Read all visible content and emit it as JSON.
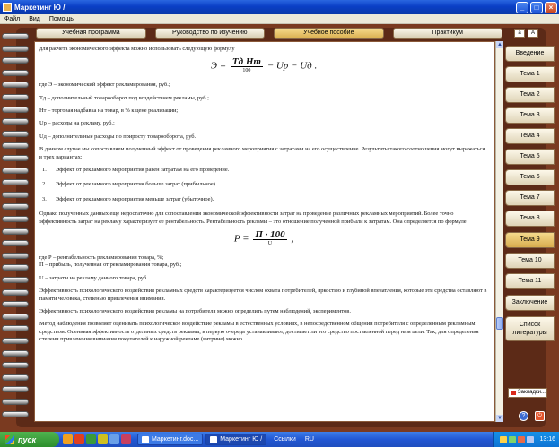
{
  "window": {
    "title": "Маркетинг Ю /"
  },
  "menu": [
    "Файл",
    "Вид",
    "Помощь"
  ],
  "tabs": [
    "Учебная программа",
    "Руководство по изучению",
    "Учебное пособие",
    "Практикум"
  ],
  "font_buttons": [
    "a",
    "A"
  ],
  "sidebar": [
    {
      "label": "Введение"
    },
    {
      "label": "Тема 1"
    },
    {
      "label": "Тема 2"
    },
    {
      "label": "Тема 3"
    },
    {
      "label": "Тема 4"
    },
    {
      "label": "Тема 5"
    },
    {
      "label": "Тема 6"
    },
    {
      "label": "Тема 7"
    },
    {
      "label": "Тема 8"
    },
    {
      "label": "Тема 9",
      "active": true
    },
    {
      "label": "Тема 10"
    },
    {
      "label": "Тема 11"
    },
    {
      "label": "Заключение"
    },
    {
      "label": "Список литературы"
    }
  ],
  "bookmark_label": "Закладки...",
  "help_label": "?",
  "content": {
    "intro": "для расчета экономического эффекта можно использовать следующую формулу",
    "formula1_left": "Э =",
    "formula1_num": "Tд Нт",
    "formula1_den": "100",
    "formula1_right": "− Uр − Uд .",
    "defs": [
      "где Э – экономический эффект рекламирования, руб.;",
      "Тд – дополнительный товарооборот под воздействием рекламы, руб.;",
      "Нт – торговая надбавка на товар, в % к цене реализации;",
      "Uр – расходы на рекламу, руб.;",
      "Uд – дополнительные расходы по приросту товарооборота, руб."
    ],
    "para1": "В данном случае мы сопоставляем полученный эффект от проведения рекламного мероприятия с затратами на его осуществление. Результаты такого соотношения могут выражаться в трех вариантах:",
    "list": [
      {
        "n": "1.",
        "text": "Эффект от рекламного мероприятия равен затратам на его проведение."
      },
      {
        "n": "2.",
        "text": "Эффект от рекламного мероприятия больше затрат (прибыльное)."
      },
      {
        "n": "3.",
        "text": "Эффект от рекламного мероприятия меньше затрат (убыточное)."
      }
    ],
    "para2": "Однако полученных данных еще недостаточно для сопоставления экономической эффективности затрат на проведение различных рекламных мероприятий. Более точно эффективность затрат на рекламу характеризует ее рентабельность. Рентабельность рекламы – это отношение полученной прибыли к затратам. Она определяется по формуле",
    "formula2_left": "P =",
    "formula2_num": "П · 100",
    "formula2_den": "U",
    "formula2_right": ",",
    "defs2_1": "где Р – рентабельность рекламирования товара, %;",
    "defs2_2": "П – прибыль, полученная от рекламирования товара, руб.;",
    "defs2_3": "U – затраты на рекламу данного товара, руб.",
    "para3": "Эффективность психологического воздействия рекламных средств характеризуется числом охвата потребителей, яркостью и глубиной впечатления, которые эти средства оставляют в памяти человека, степенью привлечения внимания.",
    "para4": "Эффективность психологического воздействия рекламы на потребителя можно определить путем наблюдений, экспериментов.",
    "para5": "Метод наблюдения позволяет оценивать психологическое воздействие рекламы в естественных условиях, в непосредственном общении потребителя с определенным рекламным средством. Оценивая эффективность отдельных средств рекламы, в первую очередь устанавливают, достигает ли это средство поставленной перед ним цели. Так, для определения степени привлечения внимания покупателей к наружной рекламе (витрине) можно"
  },
  "taskbar": {
    "start": "пуск",
    "tasks": [
      {
        "label": "Маркетинг.doc..."
      },
      {
        "label": "Маркетинг Ю /",
        "active": true
      }
    ],
    "links": "Ссылки",
    "lang": "RU",
    "clock": "13:16"
  }
}
